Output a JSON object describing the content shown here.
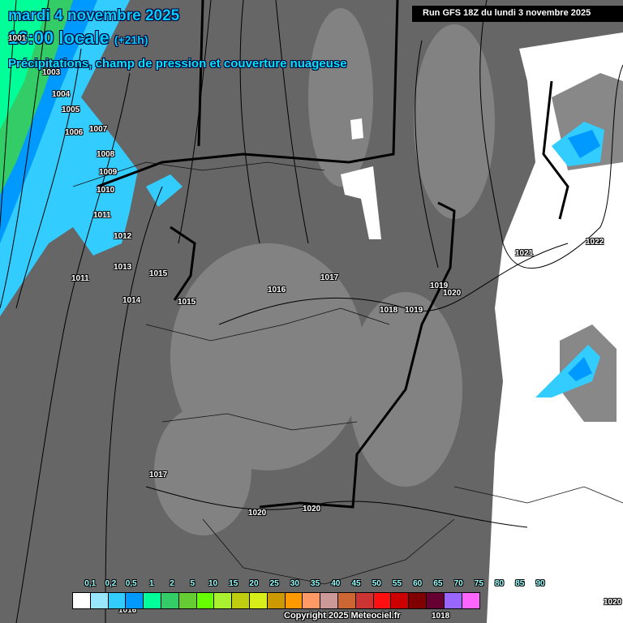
{
  "header": {
    "date": "mardi 4 novembre 2025",
    "time": "16:00 locale",
    "offset": "(+21h)",
    "product": "Précipitations, champ de pression et couverture nuageuse",
    "run": "Run GFS 18Z du lundi 3 novembre 2025"
  },
  "isobars": [
    "1001",
    "1003",
    "1004",
    "1005",
    "1006",
    "1007",
    "1008",
    "1009",
    "1010",
    "1011",
    "1012",
    "1013",
    "1011",
    "1015",
    "1014",
    "1015",
    "1016",
    "1017",
    "1018",
    "1019",
    "1019",
    "1020",
    "1021",
    "1022",
    "1017",
    "1020",
    "1020",
    "1016",
    "1018",
    "1020"
  ],
  "legend": {
    "unit_labels": [
      "0,1",
      "0,2",
      "0,5",
      "1",
      "2",
      "5",
      "10",
      "15",
      "20",
      "25",
      "30",
      "35",
      "40",
      "45",
      "50",
      "55",
      "60",
      "65",
      "70",
      "75",
      "80",
      "85",
      "90"
    ],
    "colors": [
      "#ffffff",
      "#99e6ff",
      "#33ccff",
      "#0099ff",
      "#00ff99",
      "#33cc66",
      "#66cc33",
      "#66ff00",
      "#a8f030",
      "#bfcc10",
      "#d8ee18",
      "#cc9900",
      "#ff9900",
      "#ff9966",
      "#cc9999",
      "#cc6633",
      "#cc3333",
      "#ff1010",
      "#cc0000",
      "#800000",
      "#660033",
      "#9966ff",
      "#ff66ff"
    ]
  },
  "copyright": "Copyright 2025 Meteociel.fr"
}
